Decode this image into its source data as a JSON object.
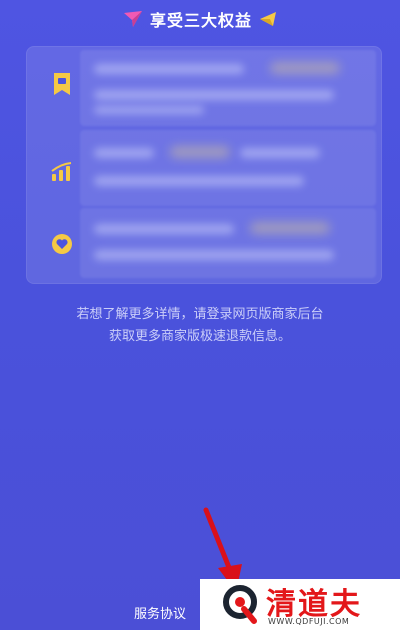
{
  "header": {
    "title": "享受三大权益"
  },
  "benefits": [
    {
      "icon": "coupon-ribbon-icon"
    },
    {
      "icon": "signal-bars-icon"
    },
    {
      "icon": "heart-badge-icon"
    }
  ],
  "info": {
    "line1": "若想了解更多详情，请登录网页版商家后台",
    "line2": "获取更多商家版极速退款信息。"
  },
  "footer": {
    "agreement_label": "服务协议"
  },
  "watermark": {
    "title": "清道夫",
    "url": "WWW.QDFUJI.COM"
  },
  "colors": {
    "background": "#4c53df",
    "accent_yellow": "#f5c945",
    "flag_pink": "#f05ab4",
    "arrow_red": "#d9101a",
    "watermark_red": "#e3171a"
  }
}
